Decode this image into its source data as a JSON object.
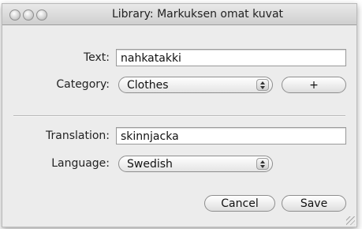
{
  "window": {
    "title": "Library: Markuksen omat kuvat"
  },
  "form": {
    "text_label": "Text:",
    "text_value": "nahkatakki",
    "category_label": "Category:",
    "category_value": "Clothes",
    "add_label": "+",
    "translation_label": "Translation:",
    "translation_value": "skinnjacka",
    "language_label": "Language:",
    "language_value": "Swedish"
  },
  "buttons": {
    "cancel": "Cancel",
    "save": "Save"
  },
  "icons": [
    "close-icon",
    "minimize-icon",
    "zoom-icon",
    "popup-arrows-icon",
    "resize-grip-icon"
  ]
}
